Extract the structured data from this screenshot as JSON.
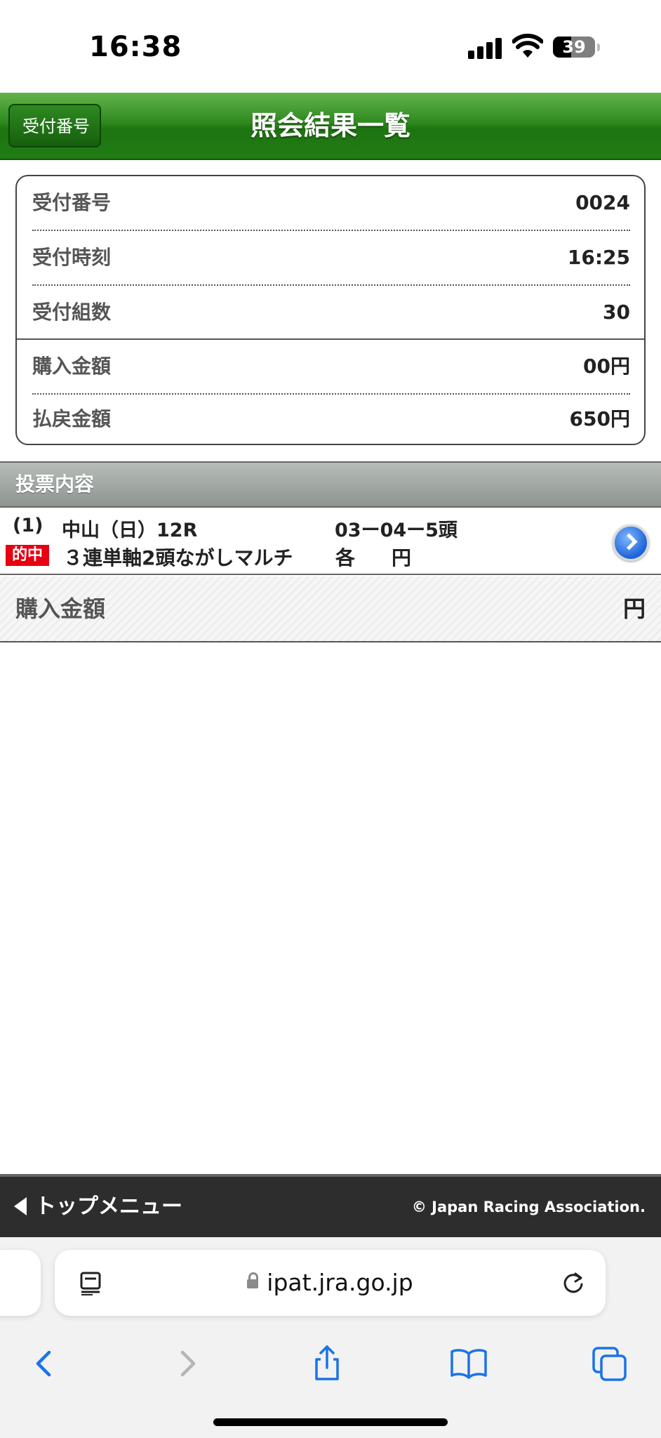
{
  "status_bar": {
    "time": "16:38",
    "battery": "39"
  },
  "header": {
    "back_label": "受付番号",
    "title": "照会結果一覧"
  },
  "info": {
    "rows": [
      {
        "label": "受付番号",
        "value": "0024"
      },
      {
        "label": "受付時刻",
        "value": "16:25"
      },
      {
        "label": "受付組数",
        "value": "30"
      },
      {
        "label": "購入金額",
        "value": "00円"
      },
      {
        "label": "払戻金額",
        "value": "650円"
      }
    ]
  },
  "section": {
    "title": "投票内容"
  },
  "bet": {
    "number": "(1)",
    "race": "中山（日）12R",
    "horses": "03ー04ー5頭",
    "hit_badge": "的中",
    "type": "３連単軸2頭ながしマルチ",
    "each": "各",
    "yen": "円"
  },
  "total": {
    "label": "購入金額",
    "value": "円"
  },
  "footer": {
    "menu_label": "トップメニュー",
    "copyright": "© Japan Racing Association."
  },
  "browser": {
    "url": "ipat.jra.go.jp"
  }
}
